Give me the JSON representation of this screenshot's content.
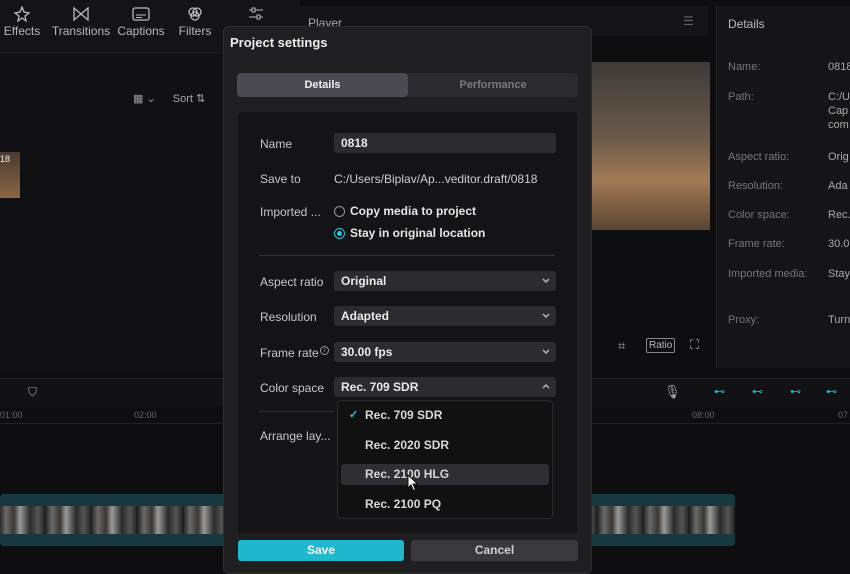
{
  "toolbar": {
    "items": [
      {
        "label": "Effects",
        "icon": "effects-icon"
      },
      {
        "label": "Transitions",
        "icon": "transitions-icon"
      },
      {
        "label": "Captions",
        "icon": "captions-icon"
      },
      {
        "label": "Filters",
        "icon": "filters-icon"
      }
    ]
  },
  "media": {
    "sort_label": "Sort",
    "thumb_label": "18"
  },
  "player": {
    "title": "Player",
    "ratio_label": "Ratio"
  },
  "details_panel": {
    "title": "Details",
    "rows": [
      {
        "label": "Name:",
        "value": "0818"
      },
      {
        "label": "Path:",
        "value": "C:/U"
      },
      {
        "label": "Aspect ratio:",
        "value": "Orig"
      },
      {
        "label": "Resolution:",
        "value": "Ada"
      },
      {
        "label": "Color space:",
        "value": "Rec."
      },
      {
        "label": "Frame rate:",
        "value": "30.0"
      },
      {
        "label": "Imported media:",
        "value": "Stay"
      },
      {
        "label": "Proxy:",
        "value": "Turn"
      }
    ],
    "path_lines": [
      "Cap",
      "com"
    ]
  },
  "timeline": {
    "ruler": [
      "01:00",
      "02:00",
      "08:00",
      "07"
    ]
  },
  "dialog": {
    "title": "Project settings",
    "tabs": {
      "details": "Details",
      "performance": "Performance"
    },
    "name_label": "Name",
    "name_value": "0818",
    "save_to_label": "Save to",
    "save_to_value": "C:/Users/Biplav/Ap...veditor.draft/0818",
    "imported_label": "Imported ...",
    "import_options": [
      "Copy media to project",
      "Stay in original location"
    ],
    "aspect_label": "Aspect ratio",
    "aspect_value": "Original",
    "resolution_label": "Resolution",
    "resolution_value": "Adapted",
    "framerate_label": "Frame rate",
    "framerate_value": "30.00 fps",
    "colorspace_label": "Color space",
    "colorspace_value": "Rec. 709 SDR",
    "arrange_label": "Arrange lay...",
    "colorspace_options": [
      "Rec. 709 SDR",
      "Rec. 2020 SDR",
      "Rec. 2100 HLG",
      "Rec. 2100 PQ"
    ],
    "save_label": "Save",
    "cancel_label": "Cancel"
  },
  "colors": {
    "accent": "#1fb8cf",
    "dialog_bg": "#1f1f22"
  }
}
